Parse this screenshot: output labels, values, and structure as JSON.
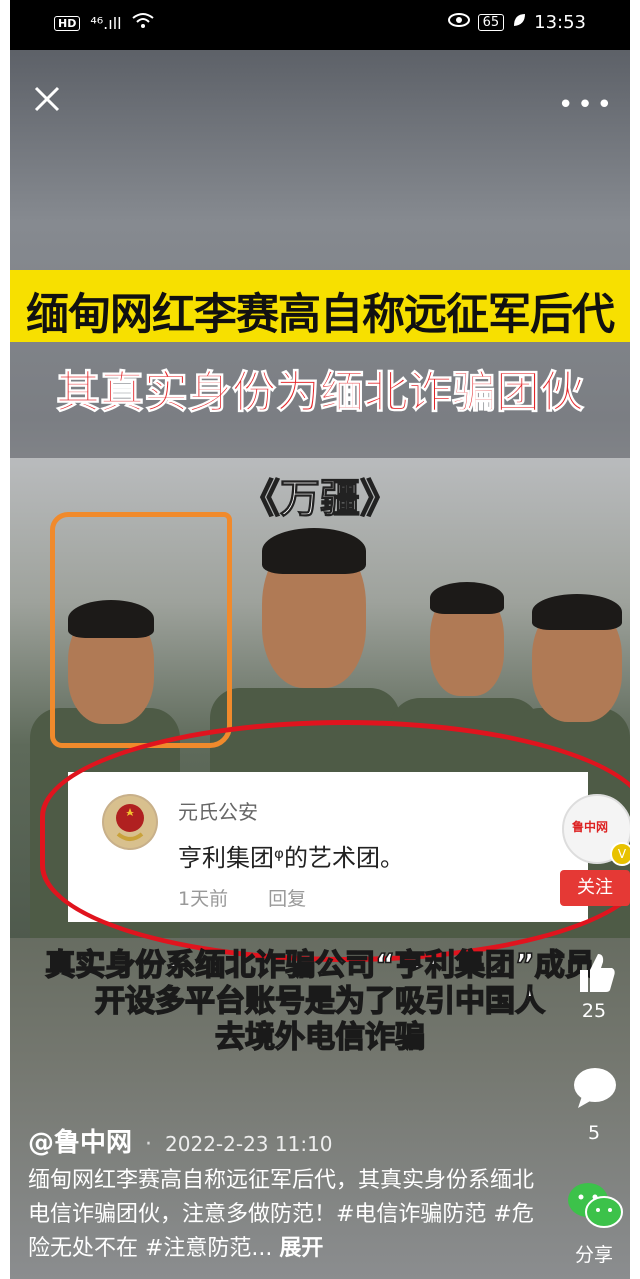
{
  "status_bar": {
    "hd": "HD",
    "signal": "⁴⁶.ıll",
    "battery": "65",
    "time": "13:53"
  },
  "video": {
    "banner_line1": "缅甸网红李赛高自称远征军后代",
    "banner_line2": "其真实身份为缅北诈骗团伙",
    "song_title": "《万疆》",
    "caption_line1": "真实身份系缅北诈骗公司“亨利集团”成员",
    "caption_line2": "开设多平台账号是为了吸引中国人",
    "caption_line3": "去境外电信诈骗"
  },
  "embedded_comment": {
    "author": "元氏公安",
    "text": "亨利集团ᵠ的艺术团。",
    "time": "1天前",
    "reply": "回复"
  },
  "sidebar": {
    "avatar_text": "鲁中网",
    "verified": "V",
    "follow": "关注",
    "likes": "25",
    "comments": "5",
    "share": "分享"
  },
  "post": {
    "handle": "@鲁中网",
    "date": "2022-2-23 11:10",
    "description": "缅甸网红李赛高自称远征军后代，其真实身份系缅北电信诈骗团伙，注意多做防范！#电信诈骗防范 #危险无处不在 #注意防范...",
    "expand": "展开"
  },
  "colors": {
    "banner_yellow": "#f7e000",
    "banner_red_text": "#e3262a",
    "follow_red": "#e53935",
    "annotation_red": "#e0141e",
    "annotation_orange": "#f08a2c"
  },
  "icons": [
    "close-icon",
    "more-icon",
    "like-icon",
    "comment-icon",
    "share-icon",
    "eye-icon",
    "wifi-icon",
    "leaf-icon"
  ]
}
